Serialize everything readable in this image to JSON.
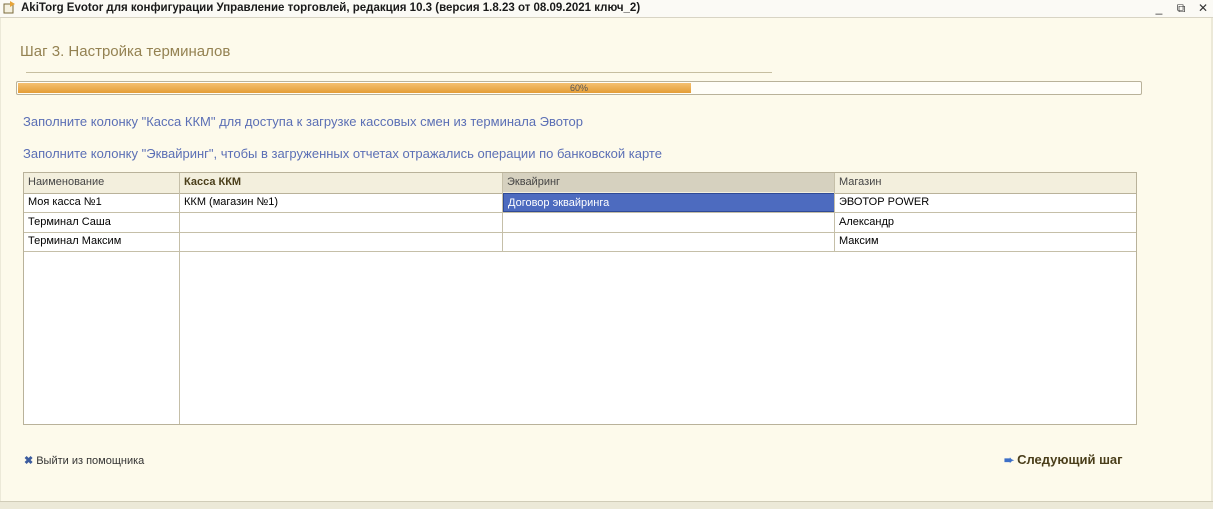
{
  "window": {
    "title": "AkiTorg Evotor для конфигурации Управление торговлей, редакция 10.3 (версия 1.8.23 от 08.09.2021 ключ_2)",
    "minimize": "_",
    "maximize": "⧉",
    "close": "✕"
  },
  "step": {
    "title": "Шаг 3. Настройка терминалов"
  },
  "progress": {
    "value": 60,
    "label": "60%"
  },
  "info": {
    "line1": "Заполните колонку \"Касса ККМ\" для доступа к загрузке кассовых смен из терминала Эвотор",
    "line2": "Заполните колонку \"Эквайринг\", чтобы в загруженных отчетах отражались операции по банковской карте"
  },
  "table": {
    "columns": [
      "Наименование",
      "Касса ККМ",
      "Эквайринг",
      "Магазин"
    ],
    "rows": [
      [
        "Моя касса №1",
        "ККМ (магазин №1)",
        "Договор эквайринга",
        "ЭВОТОР POWER"
      ],
      [
        "Терминал Саша",
        "",
        "",
        "Александр"
      ],
      [
        "Терминал Максим",
        "",
        "",
        "Максим"
      ]
    ]
  },
  "footer": {
    "exit_label": "Выйти из помощника",
    "next_label": "Следующий шаг"
  }
}
